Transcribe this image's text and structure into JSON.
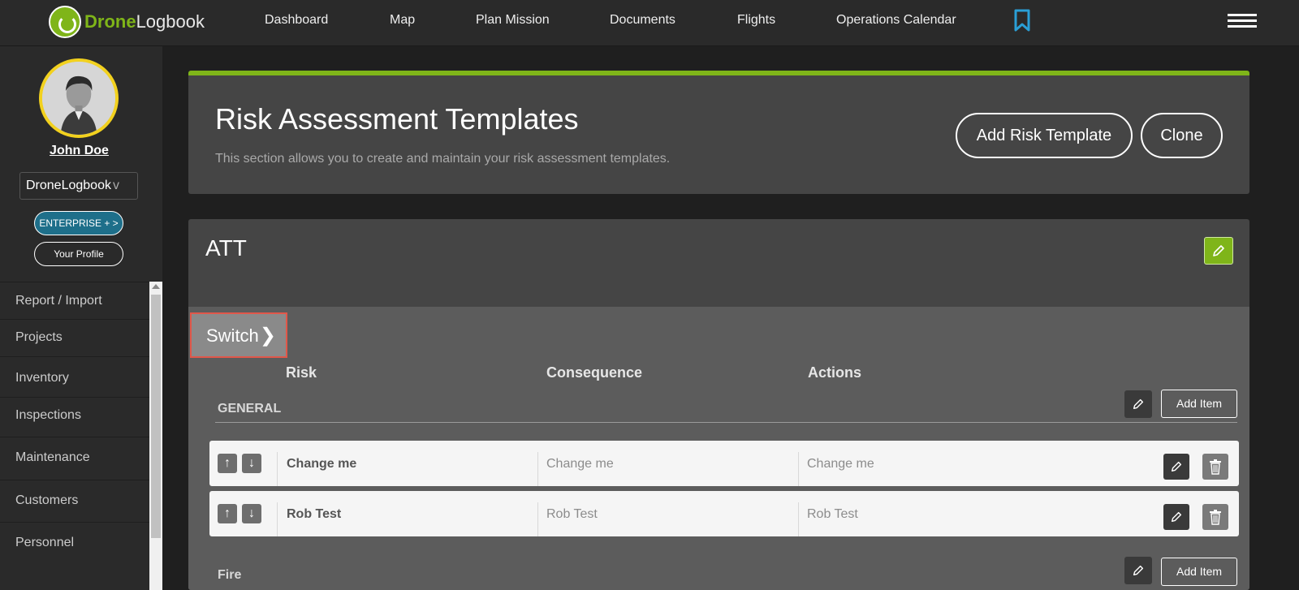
{
  "brand": {
    "part1": "Drone",
    "part2": "Logbook"
  },
  "nav": [
    "Dashboard",
    "Map",
    "Plan Mission",
    "Documents",
    "Flights",
    "Operations Calendar"
  ],
  "user": {
    "name": "John Doe",
    "org": "DroneLogbook",
    "plan_label": "ENTERPRISE + >",
    "profile_label": "Your Profile"
  },
  "sidebar_menu": [
    "Report / Import",
    "Projects",
    "Inventory",
    "Inspections",
    "Maintenance",
    "Customers",
    "Personnel"
  ],
  "page": {
    "title": "Risk Assessment Templates",
    "subtitle": "This section allows you to create and maintain your risk assessment templates.",
    "add_label": "Add Risk Template",
    "clone_label": "Clone"
  },
  "template": {
    "name": "ATT",
    "switch_label": "Switch",
    "columns": {
      "risk": "Risk",
      "consequence": "Consequence",
      "actions": "Actions"
    },
    "sections": [
      {
        "name": "GENERAL",
        "add_label": "Add Item",
        "rows": [
          {
            "risk": "Change me",
            "consequence": "Change me",
            "action": "Change me"
          },
          {
            "risk": "Rob Test",
            "consequence": "Rob Test",
            "action": "Rob Test"
          }
        ]
      },
      {
        "name": "Fire",
        "add_label": "Add Item"
      }
    ]
  },
  "colors": {
    "accent": "#7fb519",
    "enterprise": "#1e6f8a",
    "switch_border": "#e0574a"
  },
  "icons": [
    "bookmark-icon",
    "hamburger-icon",
    "pencil-icon",
    "trash-icon",
    "arrow-up-icon",
    "arrow-down-icon",
    "chevron-right-icon"
  ]
}
